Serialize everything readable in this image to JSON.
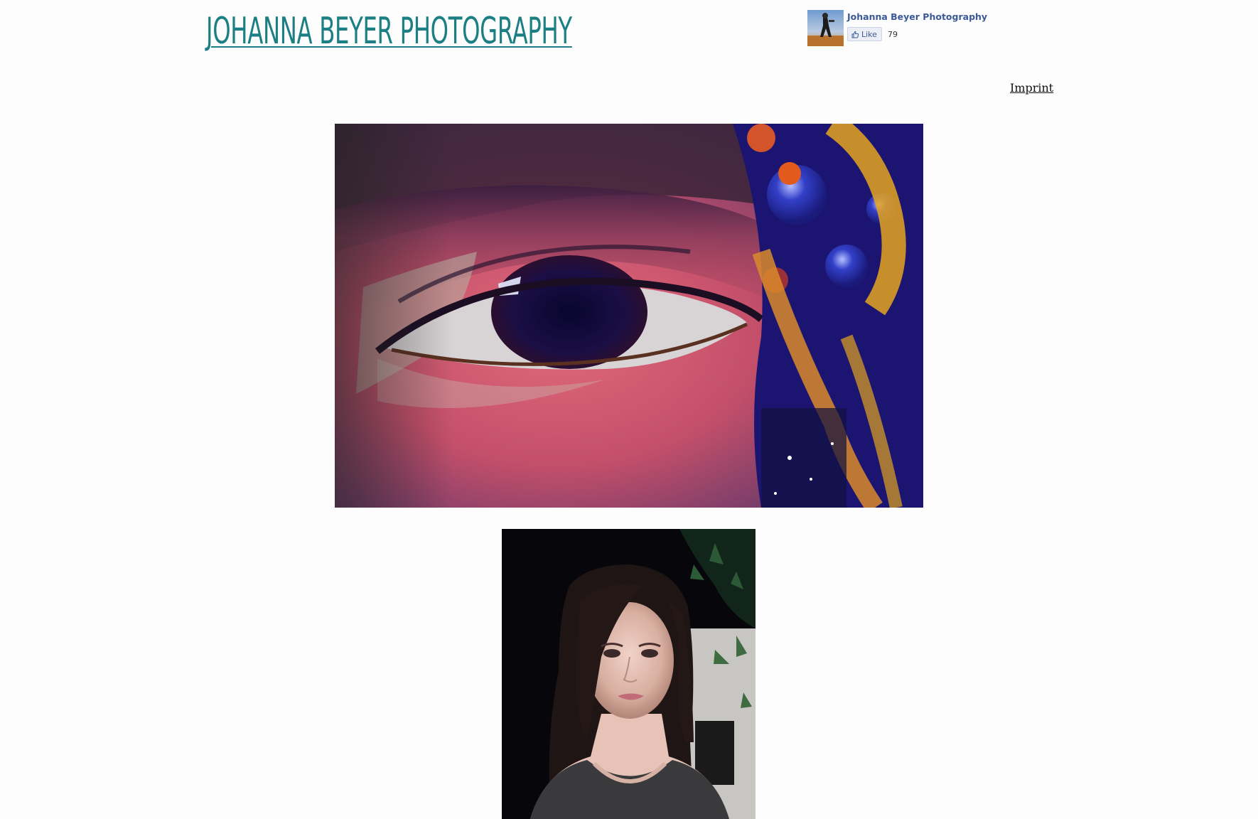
{
  "header": {
    "site_title": "JOHANNA BEYER PHOTOGRAPHY",
    "imprint_label": "Imprint"
  },
  "facebook": {
    "page_name": "Johanna Beyer Photography",
    "like_label": "Like",
    "like_count": "79",
    "thumb_icon": "thumbs-up-icon"
  },
  "gallery": {
    "images": [
      {
        "subject": "eye-closeup-photo"
      },
      {
        "subject": "portrait-photo"
      }
    ]
  },
  "colors": {
    "title": "#1b7f84",
    "fb_blue": "#3b5998",
    "background": "#fdfdfd"
  }
}
